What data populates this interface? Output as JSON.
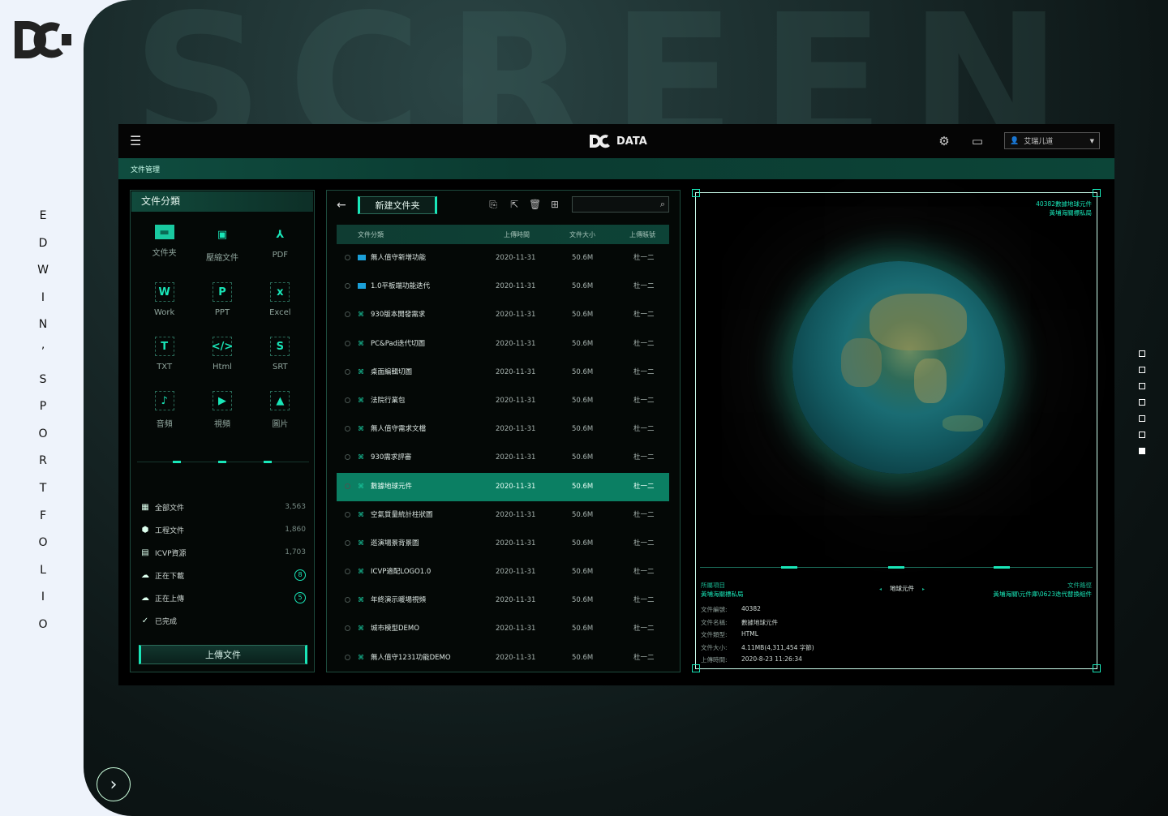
{
  "portfolio": {
    "vertical_title": [
      "E",
      "D",
      "W",
      "I",
      "N",
      "’",
      "S",
      "P",
      "O",
      "R",
      "T",
      "F",
      "O",
      "L",
      "I",
      "O"
    ],
    "bg_word": "SCREEN",
    "nav_dots": [
      false,
      false,
      false,
      false,
      false,
      false,
      true
    ]
  },
  "app": {
    "brand": "DATA",
    "user": "艾瑞儿道",
    "breadcrumb": "文件管理"
  },
  "categories": {
    "title": "文件分類",
    "items": [
      {
        "label": "文件夹",
        "glyph": "▬"
      },
      {
        "label": "壓縮文件",
        "glyph": "▣"
      },
      {
        "label": "PDF",
        "glyph": "⅄"
      },
      {
        "label": "Work",
        "glyph": "W"
      },
      {
        "label": "PPT",
        "glyph": "P"
      },
      {
        "label": "Excel",
        "glyph": "x"
      },
      {
        "label": "TXT",
        "glyph": "T"
      },
      {
        "label": "Html",
        "glyph": "</>"
      },
      {
        "label": "SRT",
        "glyph": "S"
      },
      {
        "label": "音頻",
        "glyph": "♪"
      },
      {
        "label": "視頻",
        "glyph": "▶"
      },
      {
        "label": "圖片",
        "glyph": "▲"
      }
    ],
    "stats": [
      {
        "icon": "▦",
        "label": "全部文件",
        "value": "3,563"
      },
      {
        "icon": "⬢",
        "label": "工程文件",
        "value": "1,860"
      },
      {
        "icon": "▤",
        "label": "ICVP資源",
        "value": "1,703"
      },
      {
        "icon": "☁",
        "label": "正在下載",
        "badge": "8"
      },
      {
        "icon": "☁",
        "label": "正在上傳",
        "badge": "5"
      },
      {
        "icon": "✓",
        "label": "已完成"
      }
    ],
    "upload_label": "上傳文件"
  },
  "file_list": {
    "new_folder_label": "新建文件夹",
    "search_placeholder": "",
    "columns": [
      "文件分類",
      "上傳時間",
      "文件大小",
      "上傳賬號"
    ],
    "rows": [
      {
        "name": "無人值守新增功能",
        "date": "2020-11-31",
        "size": "50.6M",
        "user": "杜一二",
        "type": "folder"
      },
      {
        "name": "1.0平板端功能迭代",
        "date": "2020-11-31",
        "size": "50.6M",
        "user": "杜一二",
        "type": "folder"
      },
      {
        "name": "930版本開發需求",
        "date": "2020-11-31",
        "size": "50.6M",
        "user": "杜一二",
        "type": "file"
      },
      {
        "name": "PC&Pad迭代切圖",
        "date": "2020-11-31",
        "size": "50.6M",
        "user": "杜一二",
        "type": "file"
      },
      {
        "name": "桌面編輯切圖",
        "date": "2020-11-31",
        "size": "50.6M",
        "user": "杜一二",
        "type": "file"
      },
      {
        "name": "法院行業包",
        "date": "2020-11-31",
        "size": "50.6M",
        "user": "杜一二",
        "type": "file"
      },
      {
        "name": "無人值守需求文檔",
        "date": "2020-11-31",
        "size": "50.6M",
        "user": "杜一二",
        "type": "file"
      },
      {
        "name": "930需求評審",
        "date": "2020-11-31",
        "size": "50.6M",
        "user": "杜一二",
        "type": "file"
      },
      {
        "name": "數據地球元件",
        "date": "2020-11-31",
        "size": "50.6M",
        "user": "杜一二",
        "type": "file",
        "selected": true
      },
      {
        "name": "空氣質量統計柱狀圖",
        "date": "2020-11-31",
        "size": "50.6M",
        "user": "杜一二",
        "type": "file"
      },
      {
        "name": "巡演場景背景圖",
        "date": "2020-11-31",
        "size": "50.6M",
        "user": "杜一二",
        "type": "file"
      },
      {
        "name": "ICVP適配LOGO1.0",
        "date": "2020-11-31",
        "size": "50.6M",
        "user": "杜一二",
        "type": "file"
      },
      {
        "name": "年終演示暖場視頻",
        "date": "2020-11-31",
        "size": "50.6M",
        "user": "杜一二",
        "type": "file"
      },
      {
        "name": "城市模型DEMO",
        "date": "2020-11-31",
        "size": "50.6M",
        "user": "杜一二",
        "type": "file"
      },
      {
        "name": "無人值守1231功能DEMO",
        "date": "2020-11-31",
        "size": "50.6M",
        "user": "杜一二",
        "type": "file"
      }
    ]
  },
  "preview": {
    "top_right": [
      "40382數據地球元件",
      "黃埔海關標私局"
    ],
    "left_label": "所屬項目",
    "left_value": "黃埔海關標私局",
    "title": "地球元件",
    "right_label": "文件路徑",
    "right_value": "黃埔海關\\元件庫\\0623迭代替換組件",
    "meta": [
      {
        "k": "文件編號:",
        "v": "40382"
      },
      {
        "k": "文件名稱:",
        "v": "數據地球元件"
      },
      {
        "k": "文件類型:",
        "v": "HTML"
      },
      {
        "k": "文件大小:",
        "v": "4.11MB(4,311,454 字節)"
      },
      {
        "k": "上傳時間:",
        "v": "2020-8-23   11:26:34"
      }
    ]
  }
}
